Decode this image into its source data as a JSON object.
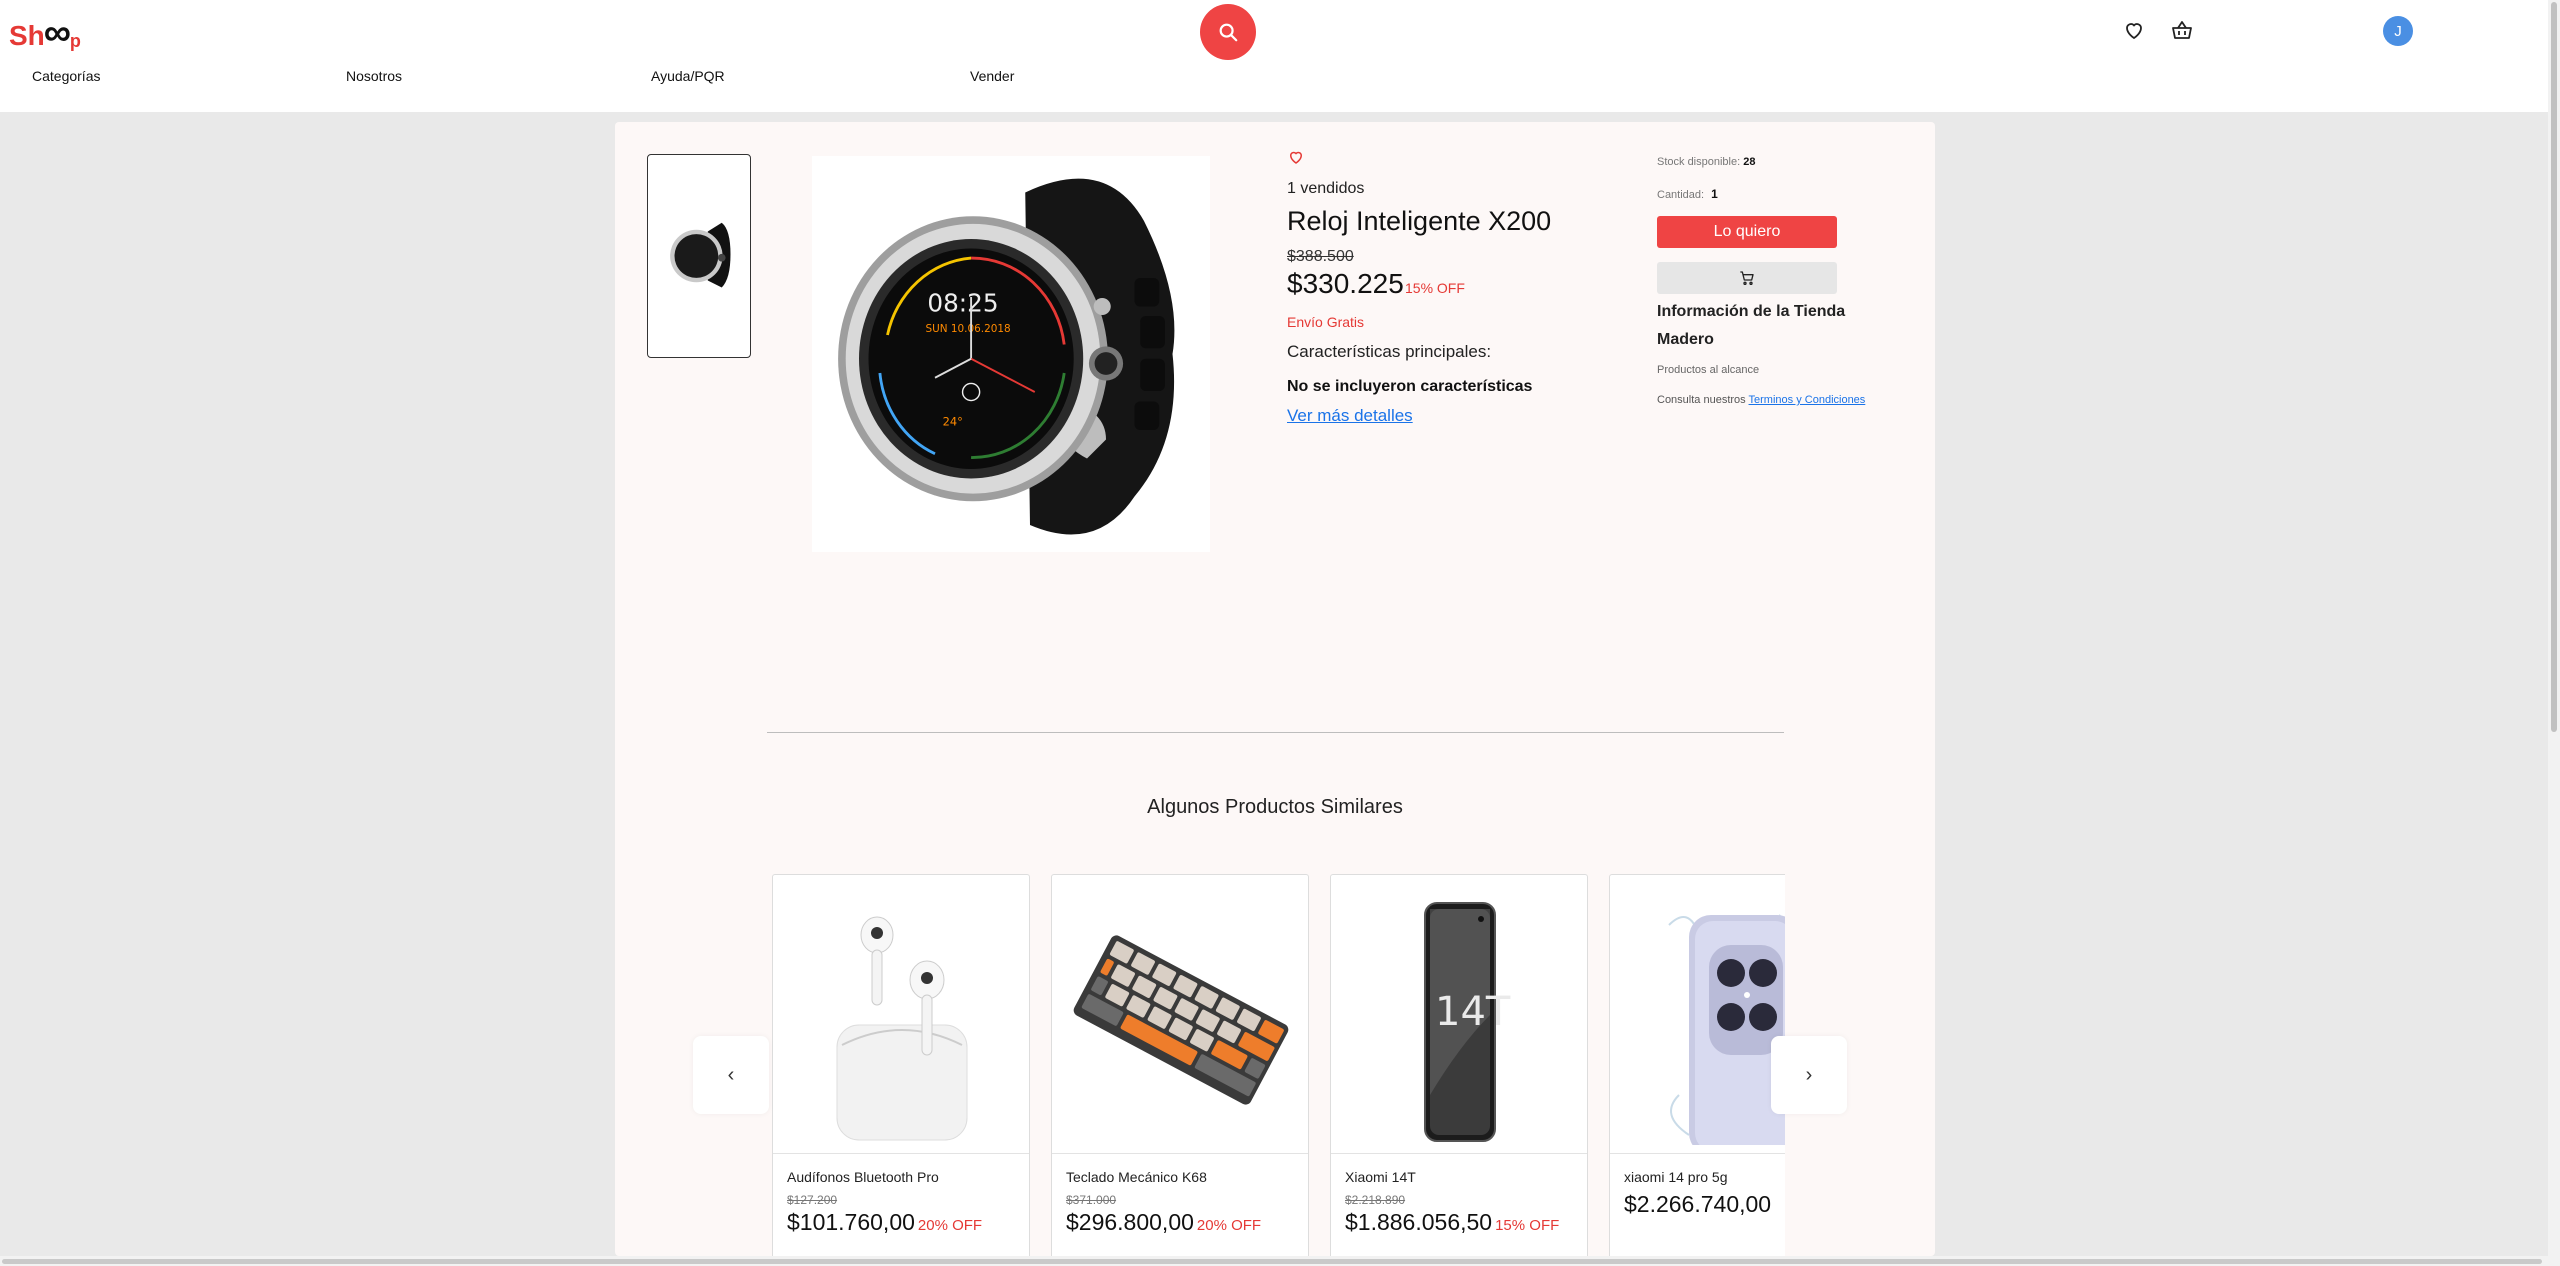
{
  "header": {
    "logo": {
      "left": "Sh",
      "right": "p"
    },
    "nav": [
      "Categorías",
      "Nosotros",
      "Ayuda/PQR",
      "Vender"
    ],
    "avatar_initial": "J",
    "accent_color": "#ef4444"
  },
  "product": {
    "sold": "1 vendidos",
    "title": "Reloj Inteligente X200",
    "old_price": "$388.500",
    "price": "$330.225",
    "discount": "15% OFF",
    "shipping": "Envío Gratis",
    "features_heading": "Características principales:",
    "features_value": "No se incluyeron características",
    "details_link": "Ver más detalles",
    "watch_time": "08:25",
    "watch_date": "SUN 10.06.2018",
    "watch_temp": "24°"
  },
  "purchase": {
    "stock_label": "Stock disponible:",
    "stock_value": "28",
    "qty_label": "Cantidad:",
    "qty_value": "1",
    "want_button": "Lo quiero",
    "store_info": "Información de la Tienda Madero",
    "store_sub": "Productos al alcance",
    "terms_prefix": "Consulta nuestros",
    "terms_link": "Terminos y Condiciones"
  },
  "similar": {
    "heading": "Algunos Productos Similares",
    "prev": "‹",
    "next": "›",
    "items": [
      {
        "name": "Audífonos Bluetooth Pro",
        "old_price": "$127.200",
        "price": "$101.760,00",
        "discount": "20% OFF"
      },
      {
        "name": "Teclado Mecánico K68",
        "old_price": "$371.000",
        "price": "$296.800,00",
        "discount": "20% OFF"
      },
      {
        "name": "Xiaomi 14T",
        "old_price": "$2.218.890",
        "price": "$1.886.056,50",
        "discount": "15% OFF",
        "screen_text": "14T"
      },
      {
        "name": "xiaomi 14 pro 5g",
        "old_price": "",
        "price": "$2.266.740,00",
        "discount": ""
      }
    ]
  }
}
